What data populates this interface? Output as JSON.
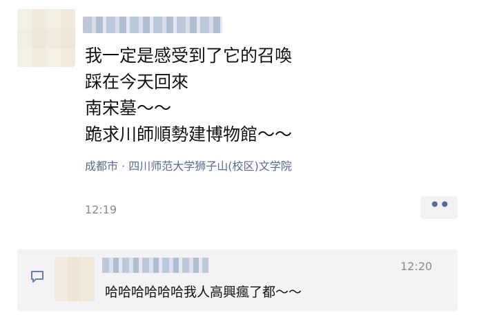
{
  "post": {
    "lines": [
      "我一定是感受到了它的召喚",
      "踩在今天回來",
      "南宋墓～～",
      "跪求川師順勢建博物館～～"
    ],
    "location": "成都市 · 四川师范大学狮子山(校区)文学院",
    "time": "12:19",
    "more_label": "••"
  },
  "comment": {
    "time": "12:20",
    "text": "哈哈哈哈哈哈我人高興瘋了都～～"
  },
  "icons": {
    "comment": "comment-icon",
    "more": "more-icon"
  }
}
